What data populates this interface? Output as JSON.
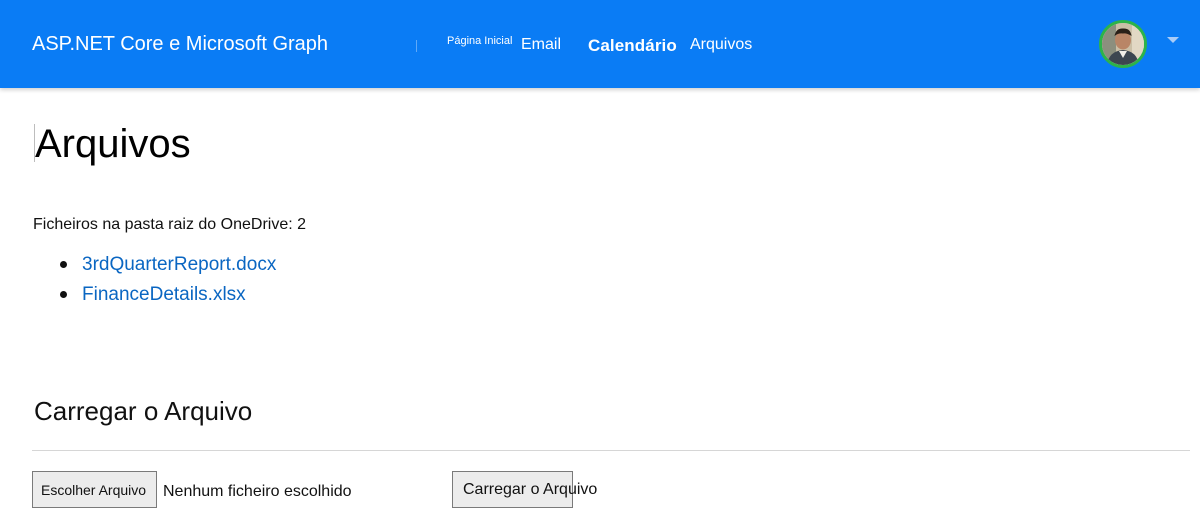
{
  "navbar": {
    "brand": "ASP.NET Core e Microsoft Graph",
    "links": {
      "home": "Página Inicial",
      "email": "Email",
      "calendar": "Calendário",
      "files": "Arquivos"
    },
    "accent_color": "#0a7cf5",
    "avatar_icon": "user-avatar",
    "menu_icon": "caret-down-icon"
  },
  "main": {
    "title": "Arquivos",
    "file_count_text": "Ficheiros na pasta raiz do OneDrive: 2",
    "files": [
      "3rdQuarterReport.docx",
      "FinanceDetails.xlsx"
    ]
  },
  "upload": {
    "heading": "Carregar o Arquivo",
    "choose_button": "Escolher Arquivo",
    "no_file_text": "Nenhum ficheiro escolhido",
    "submit_button": "Carregar o Arquivo"
  }
}
